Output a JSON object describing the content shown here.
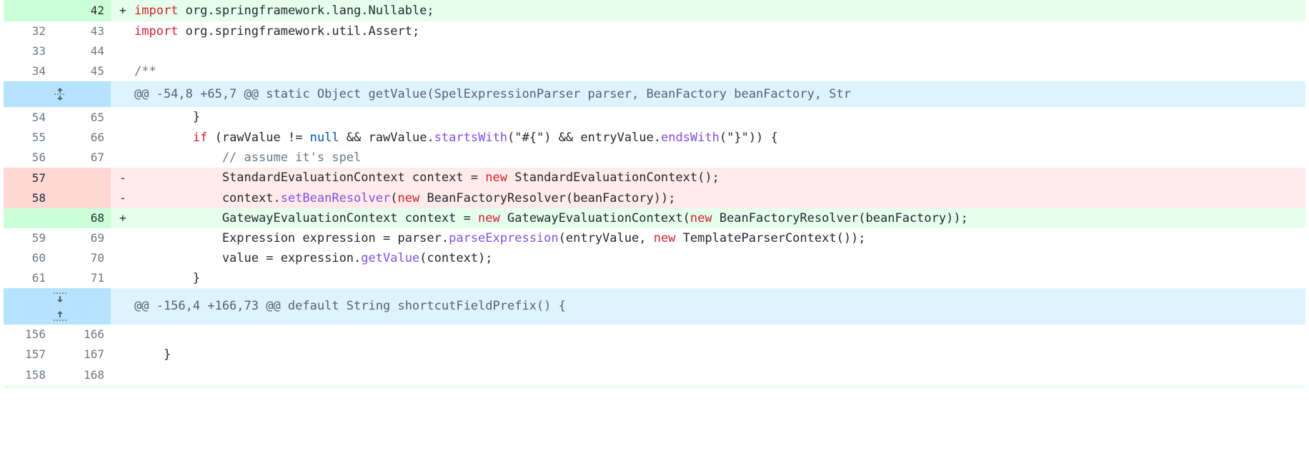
{
  "rows": [
    {
      "type": "add",
      "old": "",
      "new": "42",
      "marker": "+",
      "tokens": [
        [
          "kw",
          "import"
        ],
        [
          "t",
          " org.springframework.lang.Nullable;"
        ]
      ]
    },
    {
      "type": "context",
      "old": "32",
      "new": "43",
      "marker": "",
      "tokens": [
        [
          "kw",
          "import"
        ],
        [
          "t",
          " org.springframework.util.Assert;"
        ]
      ]
    },
    {
      "type": "context",
      "old": "33",
      "new": "44",
      "marker": "",
      "tokens": []
    },
    {
      "type": "context",
      "old": "34",
      "new": "45",
      "marker": "",
      "tokens": [
        [
          "cm",
          "/**"
        ]
      ]
    },
    {
      "type": "hunk",
      "expand": "expand-both",
      "text": "@@ -54,8 +65,7 @@ static Object getValue(SpelExpressionParser parser, BeanFactory beanFactory, Str"
    },
    {
      "type": "context",
      "old": "54",
      "new": "65",
      "marker": "",
      "tokens": [
        [
          "t",
          "        }"
        ]
      ]
    },
    {
      "type": "context",
      "old": "55",
      "new": "66",
      "marker": "",
      "tokens": [
        [
          "t",
          "        "
        ],
        [
          "kw",
          "if"
        ],
        [
          "t",
          " (rawValue != "
        ],
        [
          "lit",
          "null"
        ],
        [
          "t",
          " && rawValue."
        ],
        [
          "fn",
          "startsWith"
        ],
        [
          "t",
          "(\"#{\") && entryValue."
        ],
        [
          "fn",
          "endsWith"
        ],
        [
          "t",
          "(\"}\")) {"
        ]
      ]
    },
    {
      "type": "context",
      "old": "56",
      "new": "67",
      "marker": "",
      "tokens": [
        [
          "cm",
          "            // assume it's spel"
        ]
      ]
    },
    {
      "type": "del",
      "old": "57",
      "new": "",
      "marker": "-",
      "tokens": [
        [
          "t",
          "            StandardEvaluationContext context = "
        ],
        [
          "kw",
          "new"
        ],
        [
          "t",
          " StandardEvaluationContext();"
        ]
      ]
    },
    {
      "type": "del",
      "old": "58",
      "new": "",
      "marker": "-",
      "tokens": [
        [
          "t",
          "            context."
        ],
        [
          "fn",
          "setBeanResolver"
        ],
        [
          "t",
          "("
        ],
        [
          "kw",
          "new"
        ],
        [
          "t",
          " BeanFactoryResolver(beanFactory));"
        ]
      ]
    },
    {
      "type": "add",
      "old": "",
      "new": "68",
      "marker": "+",
      "tokens": [
        [
          "t",
          "            GatewayEvaluationContext context = "
        ],
        [
          "kw",
          "new"
        ],
        [
          "t",
          " GatewayEvaluationContext("
        ],
        [
          "kw",
          "new"
        ],
        [
          "t",
          " BeanFactoryResolver(beanFactory));"
        ]
      ]
    },
    {
      "type": "context",
      "old": "59",
      "new": "69",
      "marker": "",
      "tokens": [
        [
          "t",
          "            Expression expression = parser."
        ],
        [
          "fn",
          "parseExpression"
        ],
        [
          "t",
          "(entryValue, "
        ],
        [
          "kw",
          "new"
        ],
        [
          "t",
          " TemplateParserContext());"
        ]
      ]
    },
    {
      "type": "context",
      "old": "60",
      "new": "70",
      "marker": "",
      "tokens": [
        [
          "t",
          "            value = expression."
        ],
        [
          "fn",
          "getValue"
        ],
        [
          "t",
          "(context);"
        ]
      ]
    },
    {
      "type": "context",
      "old": "61",
      "new": "71",
      "marker": "",
      "tokens": [
        [
          "t",
          "        }"
        ]
      ]
    },
    {
      "type": "hunk",
      "expand": "expand-up-down",
      "text": "@@ -156,4 +166,73 @@ default String shortcutFieldPrefix() {"
    },
    {
      "type": "context",
      "old": "156",
      "new": "166",
      "marker": "",
      "tokens": []
    },
    {
      "type": "context",
      "old": "157",
      "new": "167",
      "marker": "",
      "tokens": [
        [
          "t",
          "    }"
        ]
      ]
    },
    {
      "type": "context",
      "old": "158",
      "new": "168",
      "marker": "",
      "tokens": []
    }
  ]
}
